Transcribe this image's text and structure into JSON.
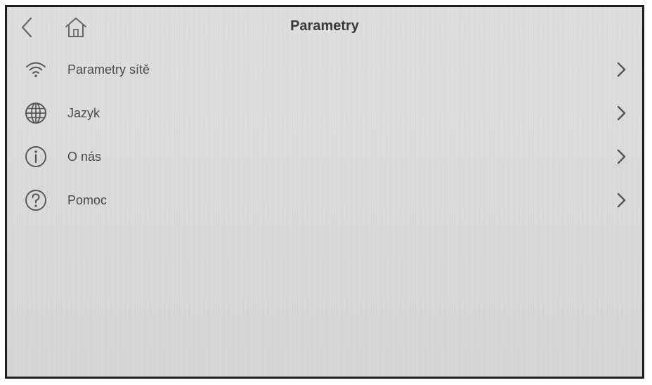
{
  "header": {
    "title": "Parametry",
    "back_icon": "chevron-left-icon",
    "home_icon": "home-icon"
  },
  "menu": {
    "items": [
      {
        "label": "Parametry sítě",
        "icon": "wifi-icon"
      },
      {
        "label": "Jazyk",
        "icon": "globe-icon"
      },
      {
        "label": "O nás",
        "icon": "info-icon"
      },
      {
        "label": "Pomoc",
        "icon": "help-icon"
      }
    ]
  },
  "colors": {
    "background": "#d9d9d9",
    "text": "#4a4a4a",
    "title": "#3a3a3a",
    "icon": "#555555"
  }
}
